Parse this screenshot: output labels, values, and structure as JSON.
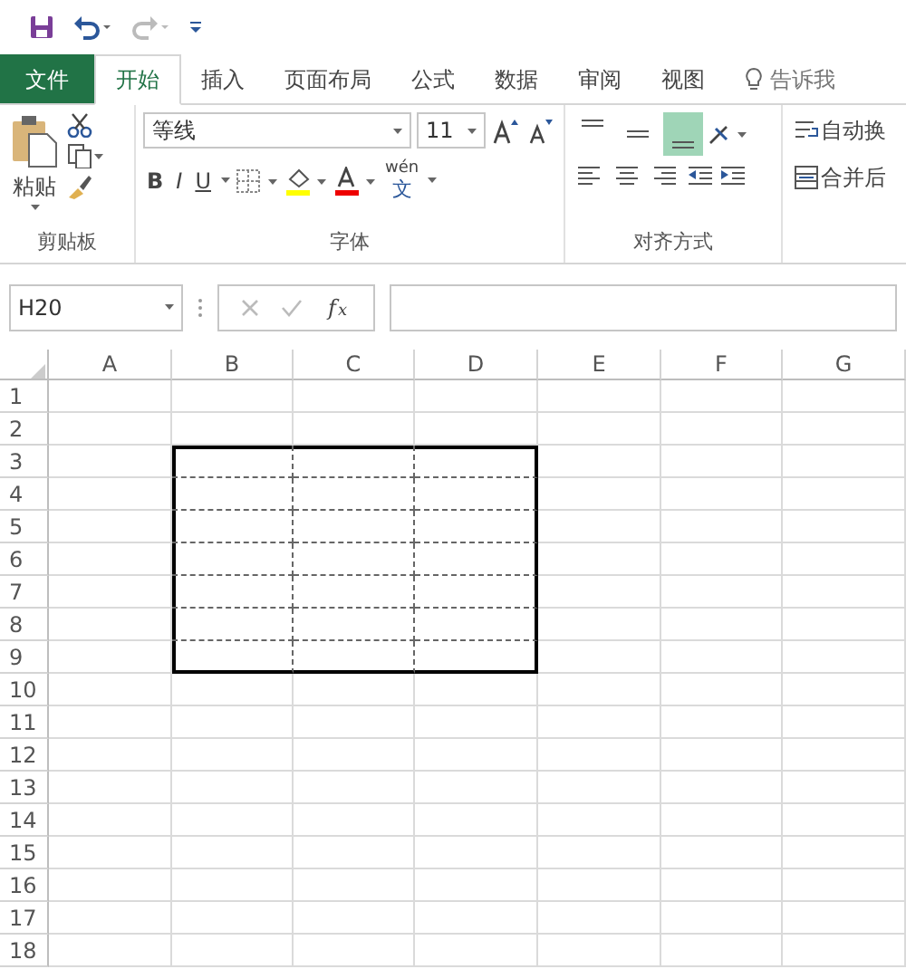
{
  "quick_access": {
    "buttons": [
      {
        "kind": "save"
      },
      {
        "kind": "undo"
      },
      {
        "kind": "redo",
        "disabled": true
      },
      {
        "kind": "customize"
      }
    ]
  },
  "tabs": [
    {
      "label": "文件",
      "kind": "file",
      "selected": false
    },
    {
      "label": "开始",
      "kind": "tab",
      "selected": true
    },
    {
      "label": "插入",
      "kind": "tab",
      "selected": false
    },
    {
      "label": "页面布局",
      "kind": "tab",
      "selected": false
    },
    {
      "label": "公式",
      "kind": "tab",
      "selected": false
    },
    {
      "label": "数据",
      "kind": "tab",
      "selected": false
    },
    {
      "label": "审阅",
      "kind": "tab",
      "selected": false
    },
    {
      "label": "视图",
      "kind": "tab",
      "selected": false
    },
    {
      "label": "告诉我",
      "kind": "tell_me",
      "selected": false
    }
  ],
  "ribbon": {
    "clipboard": {
      "paste_label": "粘贴",
      "group_label": "剪贴板"
    },
    "font": {
      "font_name": "等线",
      "font_size": "11",
      "format_buttons": [
        {
          "kind": "bold",
          "label": "B",
          "selected": false
        },
        {
          "kind": "italic",
          "label": "I",
          "selected": false
        },
        {
          "kind": "underline",
          "label": "U",
          "selected": false
        }
      ],
      "phonetic_label": "wén",
      "phonetic_char": "文",
      "group_label": "字体"
    },
    "alignment": {
      "vertical": [
        {
          "kind": "top",
          "selected": false
        },
        {
          "kind": "middle",
          "selected": false
        },
        {
          "kind": "bottom",
          "selected": true
        }
      ],
      "horizontal": [
        {
          "kind": "left",
          "selected": false
        },
        {
          "kind": "center",
          "selected": false
        },
        {
          "kind": "right",
          "selected": false
        }
      ],
      "group_label": "对齐方式"
    },
    "wrap_text": "自动换",
    "merge_center": "合并后"
  },
  "formula_bar": {
    "name_box": "H20",
    "fx": "f$_{x}$"
  },
  "sheet": {
    "columns": [
      "A",
      "B",
      "C",
      "D",
      "E",
      "F",
      "G"
    ],
    "rows": [
      {
        "label": "1",
        "cells": [
          {
            "bordered": false
          },
          {
            "bordered": false
          },
          {
            "bordered": false
          },
          {
            "bordered": false
          },
          {
            "bordered": false
          },
          {
            "bordered": false
          },
          {
            "bordered": false
          }
        ]
      },
      {
        "label": "2",
        "cells": [
          {
            "bordered": false
          },
          {
            "bordered": false
          },
          {
            "bordered": false
          },
          {
            "bordered": false
          },
          {
            "bordered": false
          },
          {
            "bordered": false
          },
          {
            "bordered": false
          }
        ]
      },
      {
        "label": "3",
        "cells": [
          {
            "bordered": false
          },
          {
            "bordered": true
          },
          {
            "bordered": true
          },
          {
            "bordered": true
          },
          {
            "bordered": false
          },
          {
            "bordered": false
          },
          {
            "bordered": false
          }
        ]
      },
      {
        "label": "4",
        "cells": [
          {
            "bordered": false
          },
          {
            "bordered": true
          },
          {
            "bordered": true
          },
          {
            "bordered": true
          },
          {
            "bordered": false
          },
          {
            "bordered": false
          },
          {
            "bordered": false
          }
        ]
      },
      {
        "label": "5",
        "cells": [
          {
            "bordered": false
          },
          {
            "bordered": true
          },
          {
            "bordered": true
          },
          {
            "bordered": true
          },
          {
            "bordered": false
          },
          {
            "bordered": false
          },
          {
            "bordered": false
          }
        ]
      },
      {
        "label": "6",
        "cells": [
          {
            "bordered": false
          },
          {
            "bordered": true
          },
          {
            "bordered": true
          },
          {
            "bordered": true
          },
          {
            "bordered": false
          },
          {
            "bordered": false
          },
          {
            "bordered": false
          }
        ]
      },
      {
        "label": "7",
        "cells": [
          {
            "bordered": false
          },
          {
            "bordered": true
          },
          {
            "bordered": true
          },
          {
            "bordered": true
          },
          {
            "bordered": false
          },
          {
            "bordered": false
          },
          {
            "bordered": false
          }
        ]
      },
      {
        "label": "8",
        "cells": [
          {
            "bordered": false
          },
          {
            "bordered": true
          },
          {
            "bordered": true
          },
          {
            "bordered": true
          },
          {
            "bordered": false
          },
          {
            "bordered": false
          },
          {
            "bordered": false
          }
        ]
      },
      {
        "label": "9",
        "cells": [
          {
            "bordered": false
          },
          {
            "bordered": true
          },
          {
            "bordered": true
          },
          {
            "bordered": true
          },
          {
            "bordered": false
          },
          {
            "bordered": false
          },
          {
            "bordered": false
          }
        ]
      },
      {
        "label": "10",
        "cells": [
          {
            "bordered": false
          },
          {
            "bordered": false
          },
          {
            "bordered": false
          },
          {
            "bordered": false
          },
          {
            "bordered": false
          },
          {
            "bordered": false
          },
          {
            "bordered": false
          }
        ]
      },
      {
        "label": "11",
        "cells": [
          {
            "bordered": false
          },
          {
            "bordered": false
          },
          {
            "bordered": false
          },
          {
            "bordered": false
          },
          {
            "bordered": false
          },
          {
            "bordered": false
          },
          {
            "bordered": false
          }
        ]
      },
      {
        "label": "12",
        "cells": [
          {
            "bordered": false
          },
          {
            "bordered": false
          },
          {
            "bordered": false
          },
          {
            "bordered": false
          },
          {
            "bordered": false
          },
          {
            "bordered": false
          },
          {
            "bordered": false
          }
        ]
      },
      {
        "label": "13",
        "cells": [
          {
            "bordered": false
          },
          {
            "bordered": false
          },
          {
            "bordered": false
          },
          {
            "bordered": false
          },
          {
            "bordered": false
          },
          {
            "bordered": false
          },
          {
            "bordered": false
          }
        ]
      },
      {
        "label": "14",
        "cells": [
          {
            "bordered": false
          },
          {
            "bordered": false
          },
          {
            "bordered": false
          },
          {
            "bordered": false
          },
          {
            "bordered": false
          },
          {
            "bordered": false
          },
          {
            "bordered": false
          }
        ]
      },
      {
        "label": "15",
        "cells": [
          {
            "bordered": false
          },
          {
            "bordered": false
          },
          {
            "bordered": false
          },
          {
            "bordered": false
          },
          {
            "bordered": false
          },
          {
            "bordered": false
          },
          {
            "bordered": false
          }
        ]
      },
      {
        "label": "16",
        "cells": [
          {
            "bordered": false
          },
          {
            "bordered": false
          },
          {
            "bordered": false
          },
          {
            "bordered": false
          },
          {
            "bordered": false
          },
          {
            "bordered": false
          },
          {
            "bordered": false
          }
        ]
      },
      {
        "label": "17",
        "cells": [
          {
            "bordered": false
          },
          {
            "bordered": false
          },
          {
            "bordered": false
          },
          {
            "bordered": false
          },
          {
            "bordered": false
          },
          {
            "bordered": false
          },
          {
            "bordered": false
          }
        ]
      },
      {
        "label": "18",
        "cells": [
          {
            "bordered": false
          },
          {
            "bordered": false
          },
          {
            "bordered": false
          },
          {
            "bordered": false
          },
          {
            "bordered": false
          },
          {
            "bordered": false
          },
          {
            "bordered": false
          }
        ]
      }
    ]
  }
}
